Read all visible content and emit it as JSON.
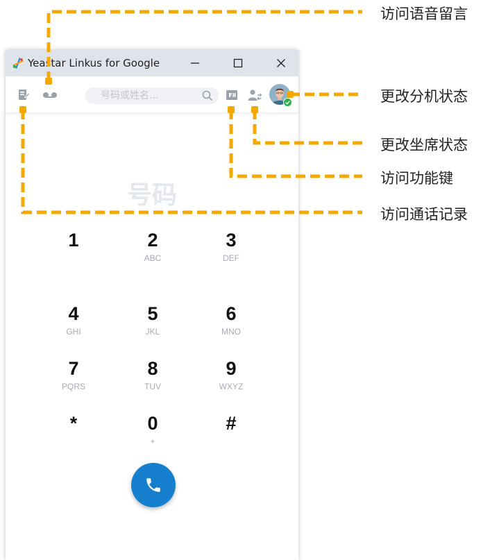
{
  "window": {
    "title": "Yeastar Linkus for Google"
  },
  "toolbar": {
    "search_placeholder": "号码或姓名..."
  },
  "display": {
    "placeholder": "号码"
  },
  "keypad": [
    {
      "digit": "1",
      "letters": ""
    },
    {
      "digit": "2",
      "letters": "ABC"
    },
    {
      "digit": "3",
      "letters": "DEF"
    },
    {
      "digit": "4",
      "letters": "GHI"
    },
    {
      "digit": "5",
      "letters": "JKL"
    },
    {
      "digit": "6",
      "letters": "MNO"
    },
    {
      "digit": "7",
      "letters": "PQRS"
    },
    {
      "digit": "8",
      "letters": "TUV"
    },
    {
      "digit": "9",
      "letters": "WXYZ"
    },
    {
      "digit": "*",
      "letters": ""
    },
    {
      "digit": "0",
      "letters": "+"
    },
    {
      "digit": "#",
      "letters": ""
    }
  ],
  "callouts": {
    "voicemail": "访问语音留言",
    "extension_status": "更改分机状态",
    "agent_status": "更改坐席状态",
    "function_keys": "访问功能键",
    "call_logs": "访问通话记录"
  },
  "icons": {
    "call_logs": "call-log-icon",
    "voicemail": "voicemail-icon",
    "search": "search-icon",
    "function_keys": "function-keys-icon",
    "agent_status": "agent-status-icon",
    "avatar": "avatar",
    "call": "phone-icon"
  },
  "colors": {
    "accent": "#1680cf",
    "callout": "#f5a800",
    "status_online": "#2bb24c",
    "titlebar": "#dfe4ea",
    "icon_gray": "#9aa2ad"
  }
}
